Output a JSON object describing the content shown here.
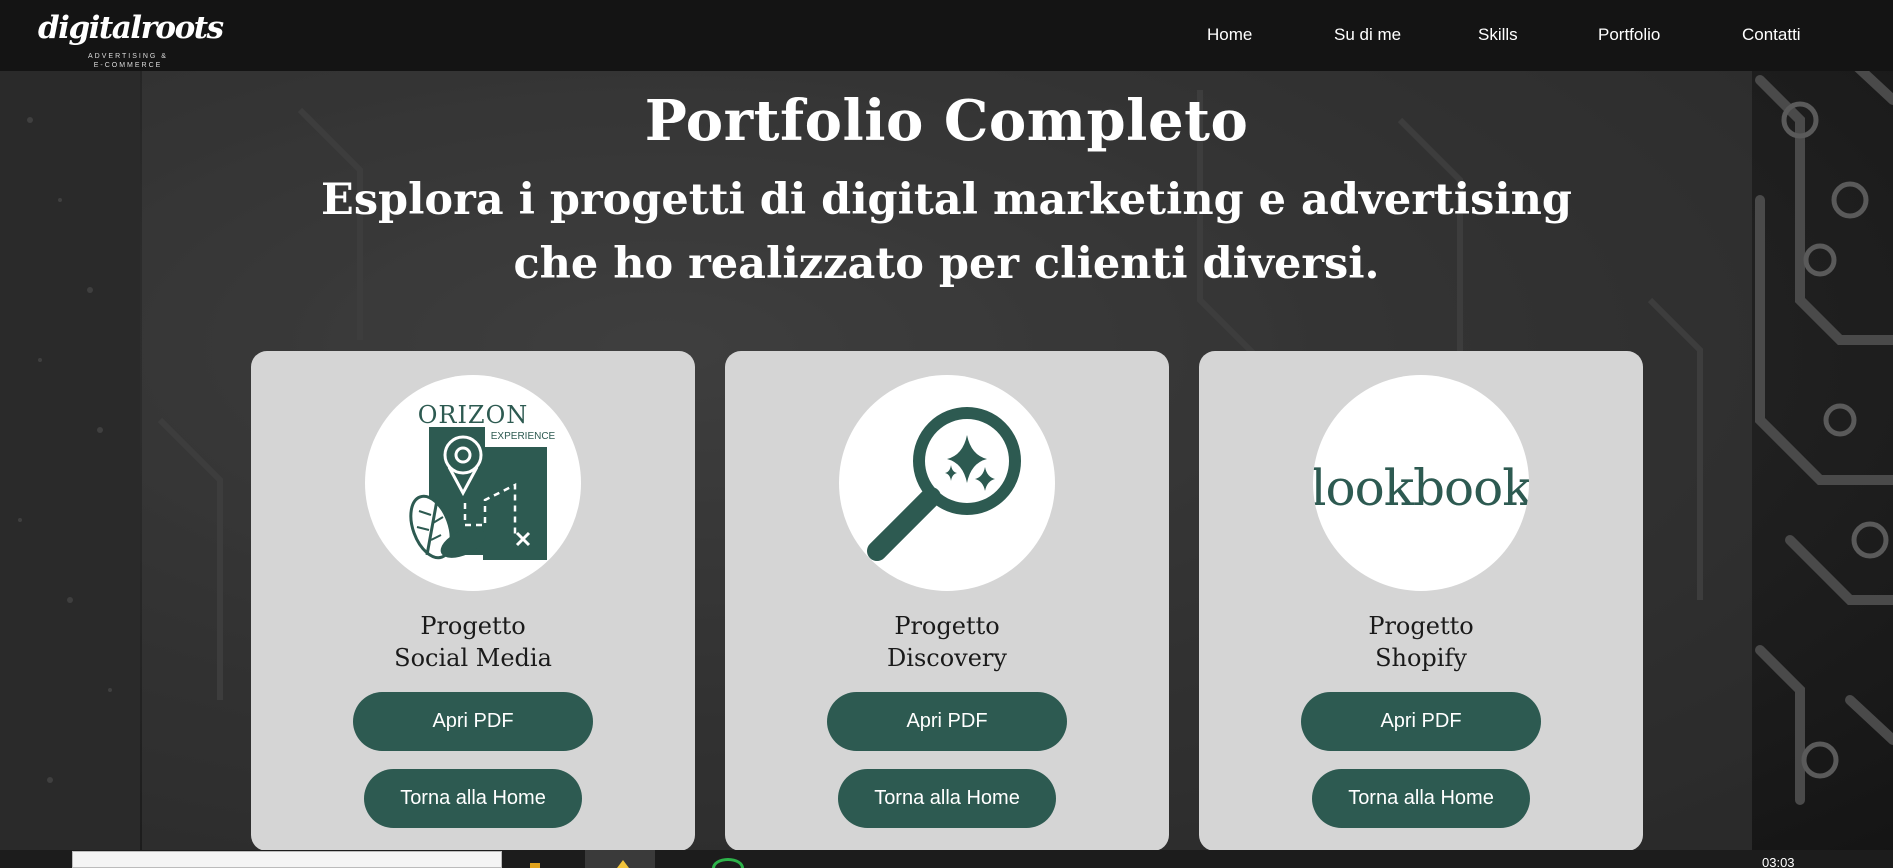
{
  "nav": {
    "logo_text": "digitalroots",
    "logo_subtitle": "ADVERTISING & E-COMMERCE",
    "links": [
      "Home",
      "Su di me",
      "Skills",
      "Portfolio",
      "Contatti"
    ]
  },
  "hero": {
    "title": "Portfolio Completo",
    "subtitle": "Esplora i progetti di digital marketing e advertising che ho realizzato per clienti diversi."
  },
  "cards": [
    {
      "title_line1": "Progetto",
      "title_line2": "Social Media",
      "logo_text": "ORIZON",
      "logo_subtext": "EXPERIENCE",
      "icon": "map-location-icon",
      "pdf_label": "Apri PDF",
      "home_label": "Torna alla Home"
    },
    {
      "title_line1": "Progetto",
      "title_line2": "Discovery",
      "icon": "magnifier-sparkle-icon",
      "pdf_label": "Apri PDF",
      "home_label": "Torna alla Home"
    },
    {
      "title_line1": "Progetto",
      "title_line2": "Shopify",
      "logo_text": "lookbook",
      "icon": "lookbook-logo",
      "pdf_label": "Apri PDF",
      "home_label": "Torna alla Home"
    }
  ],
  "taskbar": {
    "clock": "03:03"
  },
  "colors": {
    "accent": "#2d5a51",
    "card_bg": "#d5d5d5",
    "nav_bg": "#141414"
  }
}
